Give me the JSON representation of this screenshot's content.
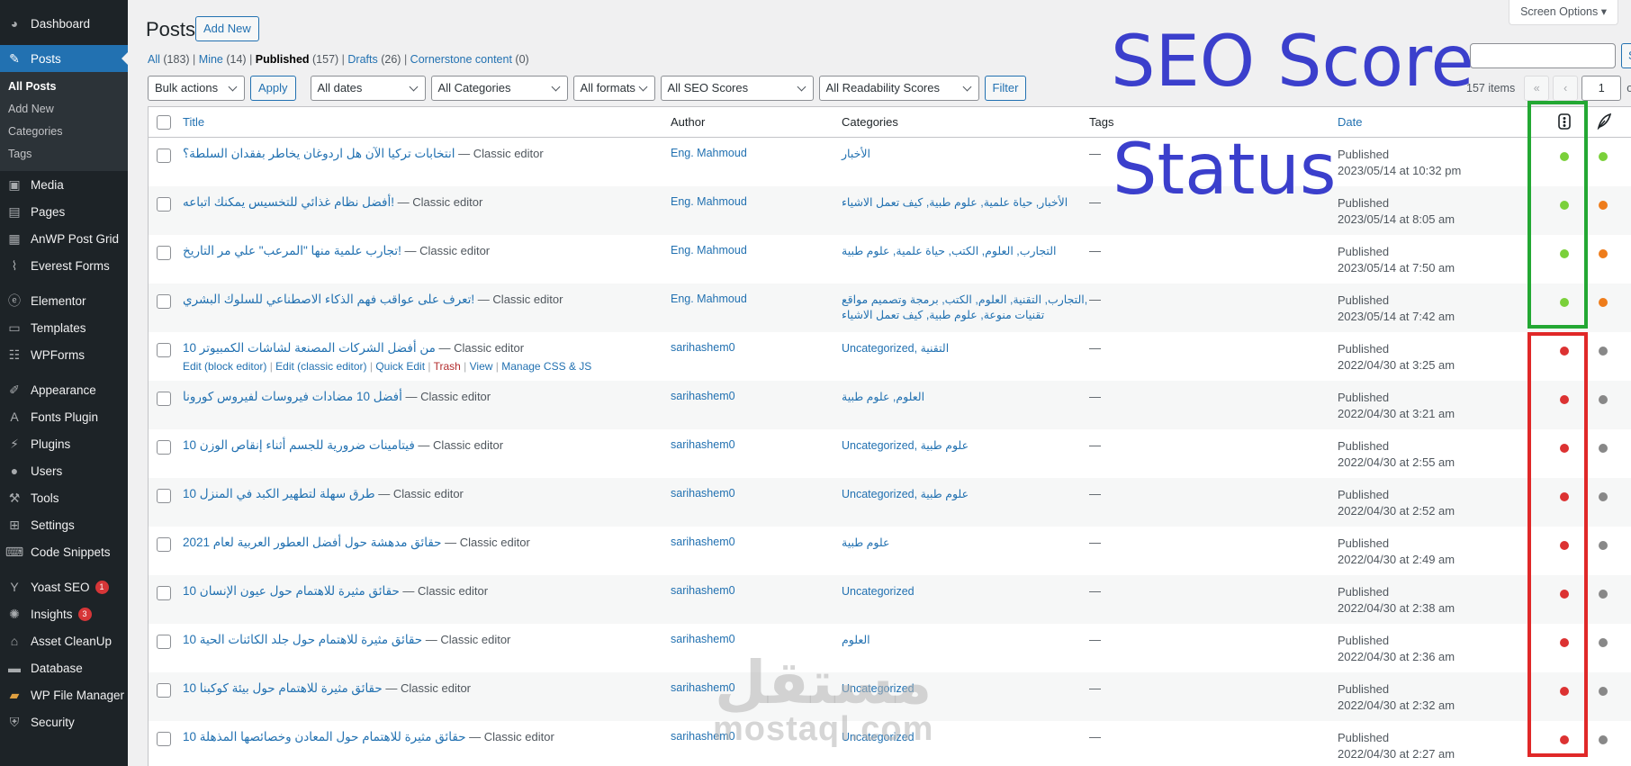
{
  "sidebar": {
    "items": [
      {
        "label": "Dashboard",
        "icon": "dashboard-icon"
      },
      {
        "label": "Posts",
        "icon": "pin-icon",
        "current": true
      },
      {
        "label": "Media",
        "icon": "media-icon"
      },
      {
        "label": "Pages",
        "icon": "pages-icon"
      },
      {
        "label": "AnWP Post Grid",
        "icon": "grid-icon"
      },
      {
        "label": "Everest Forms",
        "icon": "form-icon"
      },
      {
        "label": "Elementor",
        "icon": "elementor-icon"
      },
      {
        "label": "Templates",
        "icon": "folder-icon"
      },
      {
        "label": "WPForms",
        "icon": "wpforms-icon"
      },
      {
        "label": "Appearance",
        "icon": "brush-icon"
      },
      {
        "label": "Fonts Plugin",
        "icon": "font-icon"
      },
      {
        "label": "Plugins",
        "icon": "plug-icon"
      },
      {
        "label": "Users",
        "icon": "user-icon"
      },
      {
        "label": "Tools",
        "icon": "wrench-icon"
      },
      {
        "label": "Settings",
        "icon": "settings-icon"
      },
      {
        "label": "Code Snippets",
        "icon": "code-icon"
      },
      {
        "label": "Yoast SEO",
        "icon": "yoast-icon",
        "badge": "1"
      },
      {
        "label": "Insights",
        "icon": "insights-icon",
        "badge": "3"
      },
      {
        "label": "Asset CleanUp",
        "icon": "cleanup-icon"
      },
      {
        "label": "Database",
        "icon": "database-icon"
      },
      {
        "label": "WP File Manager",
        "icon": "file-manager-icon"
      },
      {
        "label": "Security",
        "icon": "shield-icon"
      }
    ],
    "submenu": [
      "All Posts",
      "Add New",
      "Categories",
      "Tags"
    ]
  },
  "header": {
    "title": "Posts",
    "add_new": "Add New",
    "screen_options": "Screen Options ▾"
  },
  "views": {
    "all": "All",
    "all_count": "(183)",
    "mine": "Mine",
    "mine_count": "(14)",
    "published": "Published",
    "published_count": "(157)",
    "drafts": "Drafts",
    "drafts_count": "(26)",
    "cornerstone": "Cornerstone content",
    "cornerstone_count": "(0)"
  },
  "filters": {
    "bulk_actions": "Bulk actions",
    "apply": "Apply",
    "dates": "All dates",
    "categories": "All Categories",
    "formats": "All formats",
    "seo_scores": "All SEO Scores",
    "readability": "All Readability Scores",
    "filter": "Filter"
  },
  "search": {
    "button": "S"
  },
  "pagination": {
    "items": "157 items",
    "first": "«",
    "prev": "‹",
    "page": "1",
    "of": "of"
  },
  "table": {
    "headers": {
      "title": "Title",
      "author": "Author",
      "categories": "Categories",
      "tags": "Tags",
      "date": "Date"
    },
    "row_actions": {
      "edit_block": "Edit (block editor)",
      "edit_classic": "Edit (classic editor)",
      "quick_edit": "Quick Edit",
      "trash": "Trash",
      "view": "View",
      "manage_css": "Manage CSS & JS"
    },
    "rows": [
      {
        "title": "انتخابات تركيا الآن هل اردوغان يخاطر بفقدان السلطة؟",
        "state": " — Classic editor",
        "author": "Eng. Mahmoud",
        "categories": "الأخبار",
        "tags": "—",
        "status": "Published",
        "date": "2023/05/14 at 10:32 pm",
        "seo": "green",
        "readability": "green"
      },
      {
        "title": "أفضل نظام غذائي للتخسيس يمكنك اتباعه!",
        "state": " — Classic editor",
        "author": "Eng. Mahmoud",
        "categories": "الأخبار, حياة علمية, علوم طبية, كيف تعمل الاشياء",
        "tags": "—",
        "status": "Published",
        "date": "2023/05/14 at 8:05 am",
        "seo": "green",
        "readability": "orange"
      },
      {
        "title": "تجارب علمية منها \"المرعب\" علي مر التاريخ!",
        "state": " — Classic editor",
        "author": "Eng. Mahmoud",
        "categories": "التجارب, العلوم, الكتب, حياة علمية, علوم طبية",
        "tags": "—",
        "status": "Published",
        "date": "2023/05/14 at 7:50 am",
        "seo": "green",
        "readability": "orange"
      },
      {
        "title": "تعرف على عواقب فهم الذكاء الاصطناعي للسلوك البشري!",
        "state": " — Classic editor",
        "author": "Eng. Mahmoud",
        "categories": "التجارب, التقنية, العلوم, الكتب, برمجة وتصميم مواقع,",
        "categories2": "تقنيات منوعة, علوم طبية, كيف تعمل الاشياء",
        "tags": "—",
        "status": "Published",
        "date": "2023/05/14 at 7:42 am",
        "seo": "green",
        "readability": "orange"
      },
      {
        "title": "10 من أفضل الشركات المصنعة لشاشات الكمبيوتر",
        "state": " — Classic editor",
        "author": "sarihashem0",
        "categories": "Uncategorized, التقنية",
        "tags": "—",
        "status": "Published",
        "date": "2022/04/30 at 3:25 am",
        "seo": "red",
        "readability": "gray",
        "show_actions": true
      },
      {
        "title": "أفضل 10 مضادات فيروسات لفيروس كورونا",
        "state": " — Classic editor",
        "author": "sarihashem0",
        "categories": "العلوم, علوم طبية",
        "tags": "—",
        "status": "Published",
        "date": "2022/04/30 at 3:21 am",
        "seo": "red",
        "readability": "gray"
      },
      {
        "title": "10 فيتامينات ضرورية للجسم أثناء إنقاص الوزن",
        "state": " — Classic editor",
        "author": "sarihashem0",
        "categories": "Uncategorized, علوم طبية",
        "tags": "—",
        "status": "Published",
        "date": "2022/04/30 at 2:55 am",
        "seo": "red",
        "readability": "gray"
      },
      {
        "title": "10 طرق سهلة لتطهير الكبد في المنزل",
        "state": " — Classic editor",
        "author": "sarihashem0",
        "categories": "Uncategorized, علوم طبية",
        "tags": "—",
        "status": "Published",
        "date": "2022/04/30 at 2:52 am",
        "seo": "red",
        "readability": "gray"
      },
      {
        "title": "حقائق مدهشة حول أفضل العطور العربية لعام 2021",
        "state": " — Classic editor",
        "author": "sarihashem0",
        "categories": "علوم طبية",
        "tags": "—",
        "status": "Published",
        "date": "2022/04/30 at 2:49 am",
        "seo": "red",
        "readability": "gray"
      },
      {
        "title": "10 حقائق مثيرة للاهتمام حول عيون الإنسان",
        "state": " — Classic editor",
        "author": "sarihashem0",
        "categories": "Uncategorized",
        "tags": "—",
        "status": "Published",
        "date": "2022/04/30 at 2:38 am",
        "seo": "red",
        "readability": "gray"
      },
      {
        "title": "10 حقائق مثيرة للاهتمام حول جلد الكائنات الحية",
        "state": " — Classic editor",
        "author": "sarihashem0",
        "categories": "العلوم",
        "tags": "—",
        "status": "Published",
        "date": "2022/04/30 at 2:36 am",
        "seo": "red",
        "readability": "gray"
      },
      {
        "title": "10 حقائق مثيرة للاهتمام حول بيئة كوكبنا",
        "state": " — Classic editor",
        "author": "sarihashem0",
        "categories": "Uncategorized",
        "tags": "—",
        "status": "Published",
        "date": "2022/04/30 at 2:32 am",
        "seo": "red",
        "readability": "gray"
      },
      {
        "title": "10 حقائق مثيرة للاهتمام حول المعادن وخصائصها المذهلة",
        "state": " — Classic editor",
        "author": "sarihashem0",
        "categories": "Uncategorized",
        "tags": "—",
        "status": "Published",
        "date": "2022/04/30 at 2:27 am",
        "seo": "red",
        "readability": "gray"
      }
    ]
  },
  "annotation": {
    "line1": "SEO Score",
    "line2": "Status"
  },
  "watermark": {
    "arabic": "مستقل",
    "latin": "mostaql.com"
  },
  "colors": {
    "green": "#7ad03a",
    "orange": "#ee7c1b",
    "red": "#dc3232",
    "gray": "#888888",
    "accent": "#2271b1"
  }
}
